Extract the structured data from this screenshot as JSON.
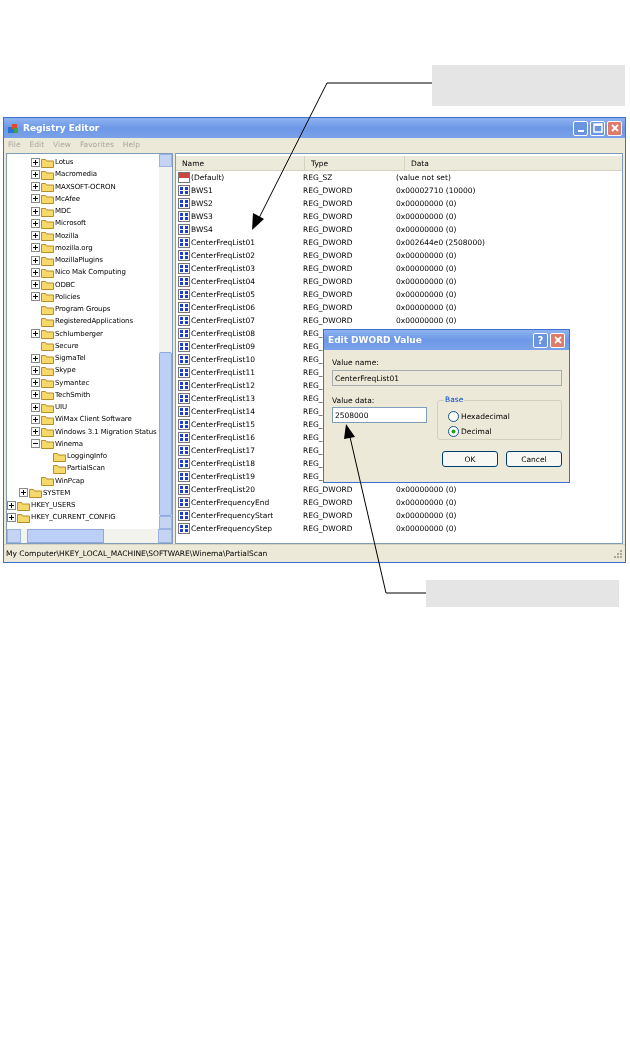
{
  "window": {
    "title": "Registry Editor"
  },
  "menu": [
    {
      "label": "File",
      "disabled": true
    },
    {
      "label": "Edit",
      "disabled": true
    },
    {
      "label": "View",
      "disabled": true
    },
    {
      "label": "Favorites",
      "disabled": true
    },
    {
      "label": "Help",
      "disabled": true
    }
  ],
  "tree": {
    "items": [
      {
        "children": [
          {
            "children": [
              {
                "label": "Lotus",
                "expanded": false
              },
              {
                "label": "Macromedia",
                "expanded": false
              },
              {
                "label": "MAXSOFT-OCRON",
                "expanded": false
              },
              {
                "label": "McAfee",
                "expanded": false
              },
              {
                "label": "MDC",
                "expanded": false
              },
              {
                "label": "Microsoft",
                "expanded": false
              },
              {
                "label": "Mozilla",
                "expanded": false
              },
              {
                "label": "mozilla.org",
                "expanded": false
              },
              {
                "label": "MozillaPlugins",
                "expanded": false
              },
              {
                "label": "Nico Mak Computing",
                "expanded": false
              },
              {
                "label": "ODBC",
                "expanded": false
              },
              {
                "label": "Policies",
                "expanded": false
              },
              {
                "label": "Program Groups"
              },
              {
                "label": "RegisteredApplications"
              },
              {
                "label": "Schlumberger",
                "expanded": false
              },
              {
                "label": "Secure"
              },
              {
                "label": "SigmaTel",
                "expanded": false
              },
              {
                "label": "Skype",
                "expanded": false
              },
              {
                "label": "Symantec",
                "expanded": false
              },
              {
                "label": "TechSmith",
                "expanded": false
              },
              {
                "label": "UIU",
                "expanded": false
              },
              {
                "label": "WiMax Client Software",
                "expanded": false
              },
              {
                "label": "Windows 3.1 Migration Status",
                "expanded": false
              },
              {
                "label": "Winema",
                "expanded": true,
                "children": [
                  {
                    "label": "LoggingInfo"
                  },
                  {
                    "label": "PartialScan"
                  }
                ]
              },
              {
                "label": "WinPcap"
              }
            ]
          },
          {
            "label": "SYSTEM",
            "expanded": false
          }
        ]
      },
      {
        "label": "HKEY_USERS",
        "expanded": false
      },
      {
        "label": "HKEY_CURRENT_CONFIG",
        "expanded": false
      }
    ]
  },
  "table": {
    "columns": [
      "Name",
      "Type",
      "Data"
    ],
    "rows": [
      {
        "kind": "string",
        "name": "(Default)",
        "type": "REG_SZ",
        "data": "(value not set)"
      },
      {
        "kind": "dword",
        "name": "BWS1",
        "type": "REG_DWORD",
        "data": "0x00002710 (10000)"
      },
      {
        "kind": "dword",
        "name": "BWS2",
        "type": "REG_DWORD",
        "data": "0x00000000 (0)"
      },
      {
        "kind": "dword",
        "name": "BWS3",
        "type": "REG_DWORD",
        "data": "0x00000000 (0)"
      },
      {
        "kind": "dword",
        "name": "BWS4",
        "type": "REG_DWORD",
        "data": "0x00000000 (0)"
      },
      {
        "kind": "dword",
        "name": "CenterFreqList01",
        "type": "REG_DWORD",
        "data": "0x002644e0 (2508000)"
      },
      {
        "kind": "dword",
        "name": "CenterFreqList02",
        "type": "REG_DWORD",
        "data": "0x00000000 (0)"
      },
      {
        "kind": "dword",
        "name": "CenterFreqList03",
        "type": "REG_DWORD",
        "data": "0x00000000 (0)"
      },
      {
        "kind": "dword",
        "name": "CenterFreqList04",
        "type": "REG_DWORD",
        "data": "0x00000000 (0)"
      },
      {
        "kind": "dword",
        "name": "CenterFreqList05",
        "type": "REG_DWORD",
        "data": "0x00000000 (0)"
      },
      {
        "kind": "dword",
        "name": "CenterFreqList06",
        "type": "REG_DWORD",
        "data": "0x00000000 (0)"
      },
      {
        "kind": "dword",
        "name": "CenterFreqList07",
        "type": "REG_DWORD",
        "data": "0x00000000 (0)"
      },
      {
        "kind": "dword",
        "name": "CenterFreqList08",
        "type": "REG_"
      },
      {
        "kind": "dword",
        "name": "CenterFreqList09",
        "type": "REG_"
      },
      {
        "kind": "dword",
        "name": "CenterFreqList10",
        "type": "REG_"
      },
      {
        "kind": "dword",
        "name": "CenterFreqList11",
        "type": "REG_"
      },
      {
        "kind": "dword",
        "name": "CenterFreqList12",
        "type": "REG_"
      },
      {
        "kind": "dword",
        "name": "CenterFreqList13",
        "type": "REG_"
      },
      {
        "kind": "dword",
        "name": "CenterFreqList14",
        "type": "REG_"
      },
      {
        "kind": "dword",
        "name": "CenterFreqList15",
        "type": "REG_"
      },
      {
        "kind": "dword",
        "name": "CenterFreqList16",
        "type": "REG_"
      },
      {
        "kind": "dword",
        "name": "CenterFreqList17",
        "type": "REG_"
      },
      {
        "kind": "dword",
        "name": "CenterFreqList18",
        "type": "REG_"
      },
      {
        "kind": "dword",
        "name": "CenterFreqList19",
        "type": "REG_"
      },
      {
        "kind": "dword",
        "name": "CenterFreqList20",
        "type": "REG_DWORD",
        "data": "0x00000000 (0)"
      },
      {
        "kind": "dword",
        "name": "CenterFrequencyEnd",
        "type": "REG_DWORD",
        "data": "0x00000000 (0)"
      },
      {
        "kind": "dword",
        "name": "CenterFrequencyStart",
        "type": "REG_DWORD",
        "data": "0x00000000 (0)"
      },
      {
        "kind": "dword",
        "name": "CenterFrequencyStep",
        "type": "REG_DWORD",
        "data": "0x00000000 (0)"
      }
    ]
  },
  "status_bar": "My Computer\\HKEY_LOCAL_MACHINE\\SOFTWARE\\Winema\\PartialScan",
  "dialog": {
    "title": "Edit DWORD Value",
    "help_button": "?",
    "value_name_label": "Value name:",
    "value_name": "CenterFreqList01",
    "value_data_label": "Value data:",
    "value_data": "2508000",
    "base_label": "Base",
    "base_options": [
      {
        "label": "Hexadecimal",
        "selected": false
      },
      {
        "label": "Decimal",
        "selected": true
      }
    ],
    "buttons": [
      "OK",
      "Cancel"
    ]
  }
}
